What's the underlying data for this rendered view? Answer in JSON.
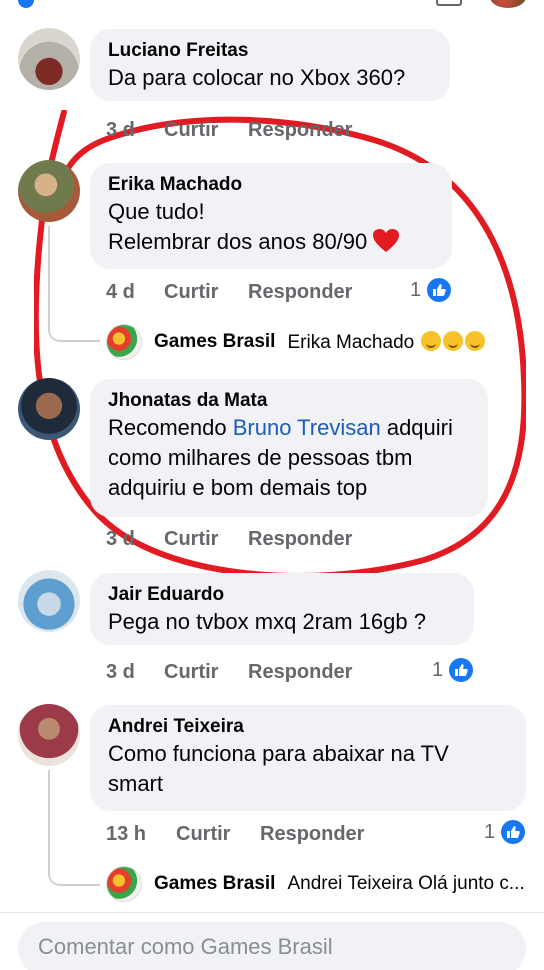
{
  "comments": [
    {
      "author": "Luciano Freitas",
      "text": "Da para colocar no Xbox 360?",
      "time": "3 d",
      "like_action": "Curtir",
      "reply_action": "Responder"
    },
    {
      "author": "Erika Machado",
      "text_line1": "Que tudo!",
      "text_line2": "Relembrar dos anos 80/90",
      "time": "4 d",
      "like_action": "Curtir",
      "reply_action": "Responder",
      "likes": "1",
      "reply": {
        "page": "Games Brasil",
        "mention": "Erika Machado"
      }
    },
    {
      "author": "Jhonatas da Mata",
      "text_pre": "Recomendo ",
      "text_link": "Bruno Trevisan",
      "text_post": " adquiri como milhares de pessoas tbm adquiriu e bom demais top",
      "time": "3 d",
      "like_action": "Curtir",
      "reply_action": "Responder"
    },
    {
      "author": "Jair Eduardo",
      "text": "Pega no tvbox mxq 2ram 16gb ?",
      "time": "3 d",
      "like_action": "Curtir",
      "reply_action": "Responder",
      "likes": "1"
    },
    {
      "author": "Andrei Teixeira",
      "text": "Como funciona para abaixar na TV smart",
      "time": "13 h",
      "like_action": "Curtir",
      "reply_action": "Responder",
      "likes": "1",
      "reply": {
        "page": "Games Brasil",
        "mention": "Andrei Teixeira Olá junto c..."
      }
    }
  ],
  "composer": {
    "placeholder": "Comentar como Games Brasil"
  },
  "colors": {
    "bubble": "#f0f2f5",
    "meta": "#65676b",
    "link": "#1e5bbf",
    "like": "#1877f2",
    "annotation": "#e21b23"
  },
  "icons": [
    "like-thumb-icon",
    "heart-emoji-icon",
    "wink-emoji-icon"
  ]
}
